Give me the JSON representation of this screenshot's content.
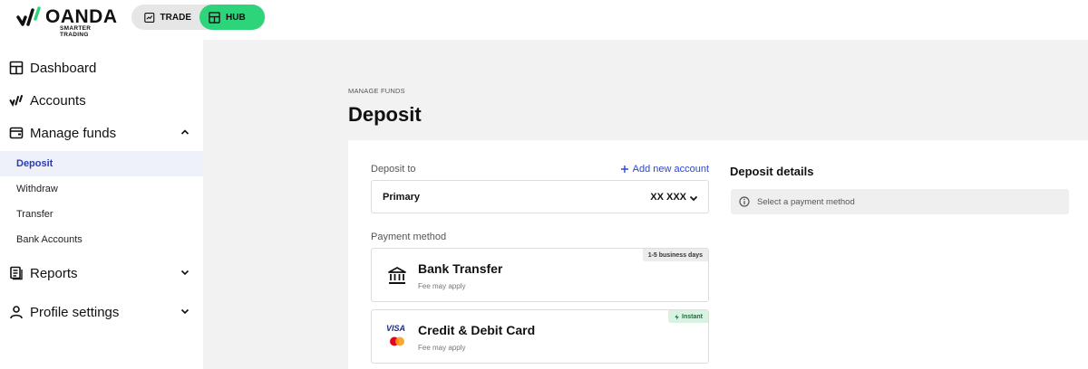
{
  "brand": {
    "name": "OANDA",
    "tagline": "SMARTER TRADING"
  },
  "topnav": {
    "trade_label": "TRADE",
    "hub_label": "HUB",
    "active": "HUB",
    "accent": "#2ed47a"
  },
  "sidebar": {
    "items": [
      {
        "label": "Dashboard",
        "icon": "dashboard-icon"
      },
      {
        "label": "Accounts",
        "icon": "accounts-icon"
      },
      {
        "label": "Manage funds",
        "icon": "wallet-icon",
        "expanded": true
      },
      {
        "label": "Reports",
        "icon": "reports-icon"
      },
      {
        "label": "Profile settings",
        "icon": "user-icon"
      }
    ],
    "subitems": [
      {
        "label": "Deposit",
        "active": true
      },
      {
        "label": "Withdraw"
      },
      {
        "label": "Transfer"
      },
      {
        "label": "Bank Accounts"
      }
    ]
  },
  "page": {
    "breadcrumb": "MANAGE FUNDS",
    "title": "Deposit"
  },
  "form": {
    "deposit_to_label": "Deposit to",
    "add_account_label": "Add new account",
    "account": {
      "name": "Primary",
      "number": "XX XXX"
    },
    "payment_method_label": "Payment method",
    "methods": [
      {
        "title": "Bank Transfer",
        "note": "Fee may apply",
        "badge": "1-5 business days",
        "icon": "bank-icon"
      },
      {
        "title": "Credit & Debit Card",
        "note": "Fee may apply",
        "badge": "Instant",
        "icon": "visa-mastercard-icon",
        "visa_text": "VISA"
      }
    ]
  },
  "details": {
    "title": "Deposit details",
    "placeholder": "Select a payment method"
  },
  "colors": {
    "active_link": "#2b3bb8",
    "link": "#2b46d9",
    "main_bg": "#f2f2f2"
  }
}
